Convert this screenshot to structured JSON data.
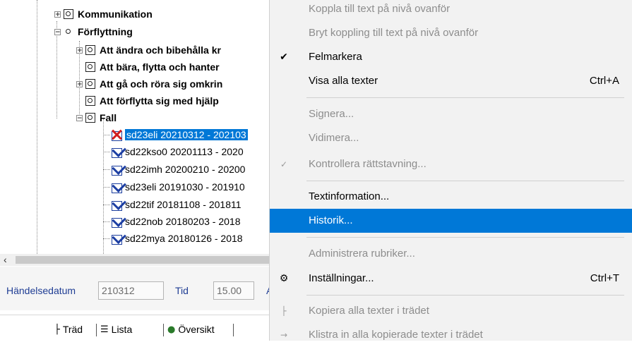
{
  "tree": {
    "items": [
      {
        "label": "Kommunikation",
        "bold": true
      },
      {
        "label": "Förflyttning",
        "bold": true
      },
      {
        "label": "Att ändra och bibehålla kr",
        "bold": true
      },
      {
        "label": "Att bära, flytta och hanter",
        "bold": true
      },
      {
        "label": "Att gå och röra sig omkrin",
        "bold": true
      },
      {
        "label": "Att förflytta sig med hjälp",
        "bold": true
      },
      {
        "label": "Fall",
        "bold": true
      },
      {
        "label": "sd23eli 20210312 - 202103",
        "selected": true
      },
      {
        "label": "sd22kso0 20201113 - 2020"
      },
      {
        "label": "sd22imh 20200210 - 20200"
      },
      {
        "label": "sd23eli 20191030 - 201910"
      },
      {
        "label": "sd22tif 20181108 - 201811"
      },
      {
        "label": "sd22nob 20180203 - 2018"
      },
      {
        "label": "sd22mya 20180126 - 2018"
      }
    ]
  },
  "fields": {
    "event_date_label": "Händelsedatum",
    "event_date_value": "210312",
    "time_label": "Tid",
    "time_value": "15.00",
    "cut_label": "A"
  },
  "tabs": [
    {
      "label": "Träd",
      "icon": "tree-icon"
    },
    {
      "label": "Lista",
      "icon": "list-icon"
    },
    {
      "label": "Översikt",
      "icon": "globe-icon"
    }
  ],
  "menu": {
    "items": [
      {
        "label": "Koppla till text på nivå ovanför",
        "disabled": true
      },
      {
        "label": "Bryt koppling till text på nivå ovanför",
        "disabled": true
      },
      {
        "label": "Felmarkera",
        "checked": true
      },
      {
        "label": "Visa alla texter",
        "shortcut": "Ctrl+A"
      },
      {
        "label": "Signera...",
        "disabled": true
      },
      {
        "label": "Vidimera...",
        "disabled": true
      },
      {
        "label": "Kontrollera rättstavning...",
        "disabled": true,
        "icon": "spellcheck-icon"
      },
      {
        "label": "Textinformation..."
      },
      {
        "label": "Historik...",
        "highlighted": true
      },
      {
        "label": "Administrera rubriker...",
        "disabled": true
      },
      {
        "label": "Inställningar...",
        "shortcut": "Ctrl+T",
        "icon": "settings-icon"
      },
      {
        "label": "Kopiera alla texter i trädet",
        "disabled": true,
        "icon": "copy-tree-icon"
      },
      {
        "label": "Klistra in alla kopierade texter i trädet",
        "disabled": true,
        "icon": "paste-tree-icon"
      }
    ]
  },
  "colors": {
    "selection": "#0078d7",
    "menu_background": "#f2f2f2",
    "label_blue": "#1f3d94",
    "disabled_text": "#8d8d8d"
  }
}
